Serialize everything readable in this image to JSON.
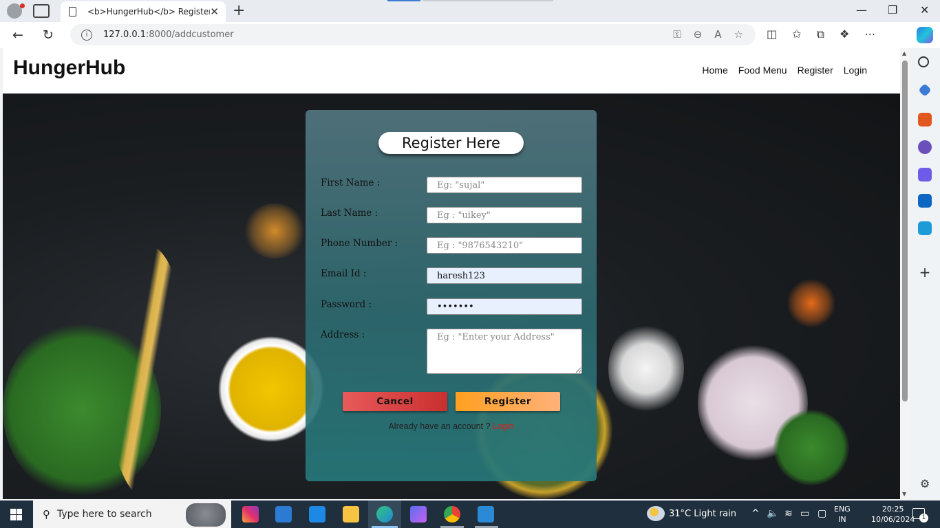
{
  "browser": {
    "tab_title": "<b>HungerHub</b> Register",
    "url_host": "127.0.0.1",
    "url_path": ":8000/addcustomer",
    "new_tab_symbol": "+",
    "close_symbol": "✕"
  },
  "site": {
    "brand": "HungerHub",
    "nav": [
      "Home",
      "Food Menu",
      "Register",
      "Login"
    ]
  },
  "form": {
    "title": "Register Here",
    "fields": [
      {
        "label": "First Name :",
        "placeholder": "Eg: \"sujal\"",
        "value": ""
      },
      {
        "label": "Last Name :",
        "placeholder": "Eg : \"uikey\"",
        "value": ""
      },
      {
        "label": "Phone Number :",
        "placeholder": "Eg : \"9876543210\"",
        "value": ""
      },
      {
        "label": "Email Id :",
        "placeholder": "",
        "value": "haresh123"
      },
      {
        "label": "Password :",
        "placeholder": "",
        "value": "•••••••"
      },
      {
        "label": "Address :",
        "placeholder": "Eg : \"Enter your Address\"",
        "value": ""
      }
    ],
    "cancel_label": "Cancel",
    "register_label": "Register",
    "already_text": "Already have an account ? ",
    "login_link": "Login"
  },
  "taskbar": {
    "search_placeholder": "Type here to search",
    "weather": "31°C  Light rain",
    "lang_line1": "ENG",
    "lang_line2": "IN",
    "time": "20:25",
    "date": "10/06/2024",
    "notification_count": "1"
  },
  "colors": {
    "cancel": "#d94040",
    "register": "#ffa63d",
    "login_link": "#e21b1b",
    "card": "#3d7d84"
  }
}
